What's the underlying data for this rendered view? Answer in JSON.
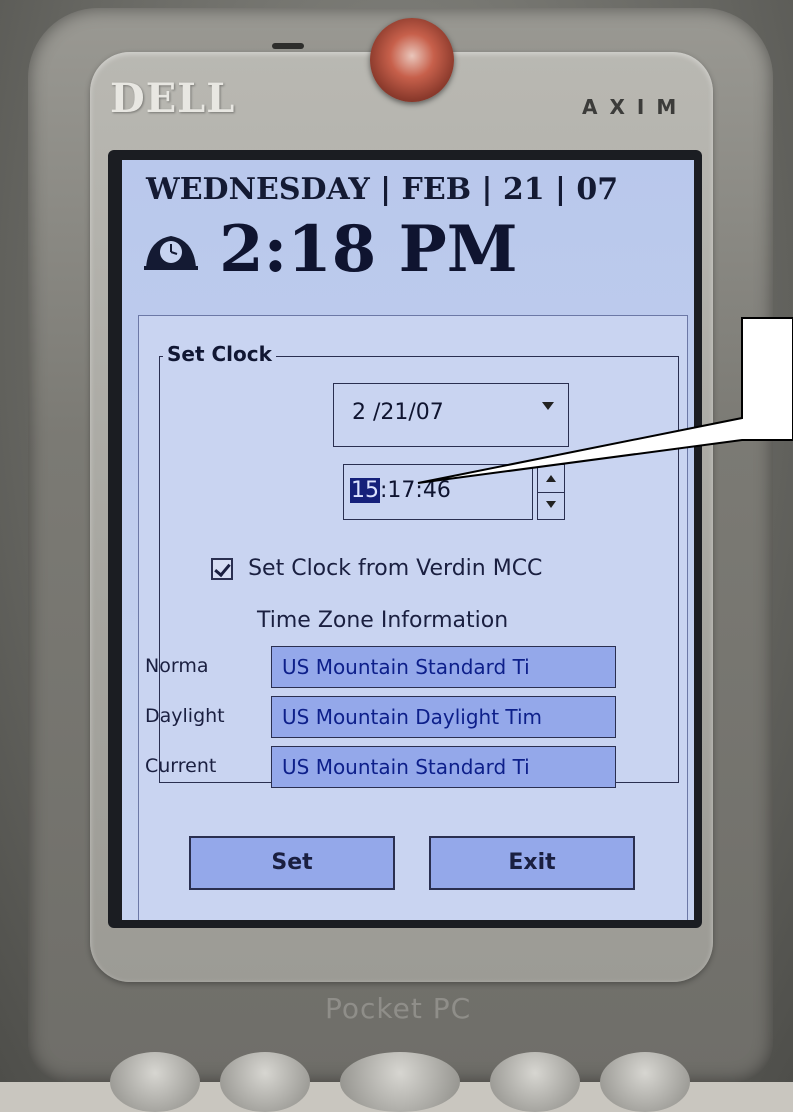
{
  "device": {
    "brand": "DELL",
    "model": "AXIM",
    "bottom_label": "Pocket PC"
  },
  "today": {
    "date_line": "WEDNESDAY | FEB | 21 | 07",
    "time": "2:18 PM"
  },
  "set_clock": {
    "group_title": "Set Clock",
    "date_value": "2 /21/07",
    "time_hour_selected": "15",
    "time_rest": ":17:46",
    "checkbox_label": "Set Clock from Verdin MCC",
    "checkbox_checked": true
  },
  "time_zone": {
    "title": "Time Zone Information",
    "rows": [
      {
        "label": "Norma",
        "value": "US Mountain Standard Ti"
      },
      {
        "label": "Daylight",
        "value": "US Mountain Daylight Tim"
      },
      {
        "label": "Current",
        "value": "US Mountain Standard Ti"
      }
    ]
  },
  "buttons": {
    "set_label": "Set",
    "exit_label": "Exit"
  },
  "icons": {
    "clock": "clock-icon",
    "dropdown": "chevron-down-icon",
    "spin_up": "arrow-up-icon",
    "spin_down": "arrow-down-icon",
    "power": "power-button-icon"
  },
  "colors": {
    "screen_bg": "#c7d3f0",
    "field_highlight": "#94a8ea",
    "selection": "#15207a",
    "power_led": "#c7604b"
  }
}
